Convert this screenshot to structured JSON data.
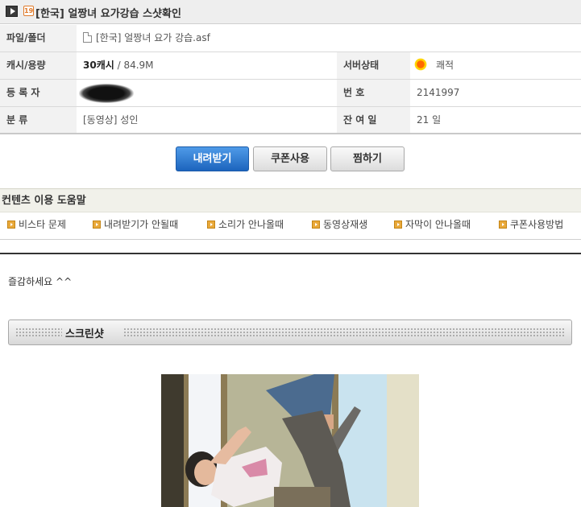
{
  "header": {
    "age_badge": "19",
    "title": "[한국] 얼짱녀 요가강습 스샷확인"
  },
  "info": {
    "file_label": "파일/폴더",
    "file_name": "[한국] 얼짱녀 요가 강습.asf",
    "size_label": "캐시/용량",
    "cache": "30캐시",
    "size": " / 84.9M",
    "status_label": "서버상태",
    "status_value": "쾌적",
    "uploader_label": "등 록 자",
    "number_label": "번 호",
    "number_value": "2141997",
    "category_label": "분 류",
    "category_value": "[동영상] 성인",
    "days_label": "잔 여 일",
    "days_value": "21 일"
  },
  "buttons": {
    "download": "내려받기",
    "coupon": "쿠폰사용",
    "bookmark": "찜하기"
  },
  "help": {
    "title": "컨텐츠 이용 도움말",
    "items": [
      "비스타 문제",
      "내려받기가 안될때",
      "소리가 안나올때",
      "동영상재생",
      "자막이 안나올때",
      "쿠폰사용방법"
    ]
  },
  "content": {
    "greeting": "즐감하세요 ^^",
    "screenshot_label": "스크린샷"
  },
  "colors": {
    "primary_button": "#2a74cc",
    "bullet": "#e9a93a"
  }
}
